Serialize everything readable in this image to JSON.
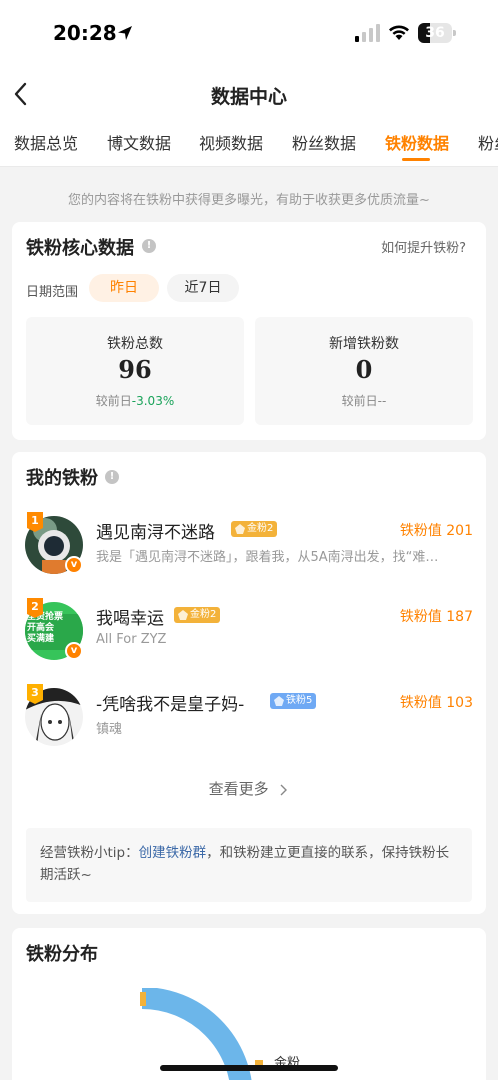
{
  "status_bar": {
    "time": "20:28",
    "battery": "36",
    "battery_level": 0.36
  },
  "header": {
    "title": "数据中心"
  },
  "tabs": [
    {
      "label": "数据总览",
      "active": false
    },
    {
      "label": "博文数据",
      "active": false
    },
    {
      "label": "视频数据",
      "active": false
    },
    {
      "label": "粉丝数据",
      "active": false
    },
    {
      "label": "铁粉数据",
      "active": true
    },
    {
      "label": "粉丝",
      "active": false
    }
  ],
  "notice": "您的内容将在铁粉中获得更多曝光，有助于收获更多优质流量~",
  "core": {
    "title": "铁粉核心数据",
    "help_link": "如何提升铁粉?",
    "date_label": "日期范围",
    "date_options": [
      "昨日",
      "近7日"
    ],
    "stats": [
      {
        "label": "铁粉总数",
        "value": "96",
        "compare_prefix": "较前日",
        "compare_value": "-3.03%"
      },
      {
        "label": "新增铁粉数",
        "value": "0",
        "compare_prefix": "较前日",
        "compare_value": "--"
      }
    ]
  },
  "my_fans": {
    "title": "我的铁粉",
    "fans": [
      {
        "rank": "1",
        "name": "遇见南浔不迷路",
        "tag": "金粉2",
        "tag_color": "#f3b23a",
        "desc": "我是「遇见南浔不迷路」，跟着我，从5A南浔出发，找“难…",
        "value": "铁粉值 201",
        "verified": true
      },
      {
        "rank": "2",
        "name": "我喝幸运",
        "tag": "金粉2",
        "tag_color": "#f3b23a",
        "desc": "All For ZYZ",
        "value": "铁粉值 187",
        "verified": true
      },
      {
        "rank": "3",
        "name": "-凭啥我不是皇子妈-",
        "tag": "铁粉5",
        "tag_color": "#6fa9f4",
        "desc": "镇魂",
        "value": "铁粉值 103",
        "verified": false
      }
    ],
    "avatar2_text": [
      "全资抢票",
      "开高会",
      "买满建"
    ],
    "more": "查看更多",
    "tip_prefix": "经营铁粉小tip：",
    "tip_link": "创建铁粉群",
    "tip_suffix": "，和铁粉建立更直接的联系，保持铁粉长期活跃~"
  },
  "distribution": {
    "title": "铁粉分布",
    "legend": [
      "金粉"
    ]
  },
  "colors": {
    "accent": "#ff8200",
    "gold": "#f3b23a",
    "blue": "#6fa9f4",
    "green": "#1aa35a",
    "link": "#3d6aa8"
  }
}
